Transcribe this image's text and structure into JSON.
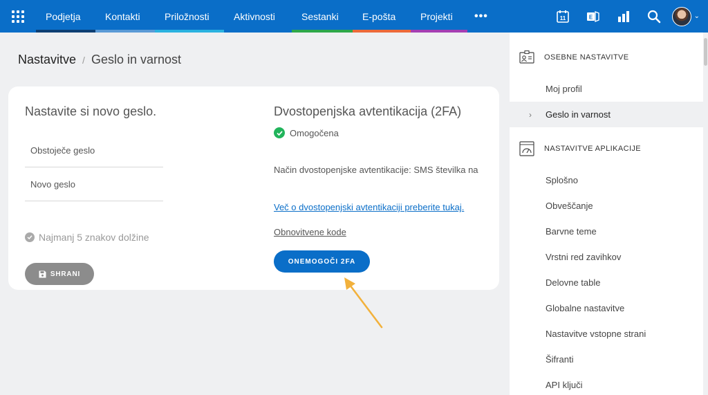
{
  "nav": {
    "tabs": [
      {
        "label": "Podjetja",
        "color": "#0d3f73"
      },
      {
        "label": "Kontakti",
        "color": "#5b9ad6"
      },
      {
        "label": "Priložnosti",
        "color": "#2ab2e0"
      },
      {
        "label": "Aktivnosti",
        "color": "#0a6ec8"
      },
      {
        "label": "Sestanki",
        "color": "#2ea84a"
      },
      {
        "label": "E-pošta",
        "color": "#ec6a3a"
      },
      {
        "label": "Projekti",
        "color": "#a53fb3"
      }
    ],
    "calendar_day": "11",
    "icons": [
      "apps-grid-icon",
      "more-icon",
      "calendar-icon",
      "exchange-icon",
      "reports-icon",
      "search-icon",
      "avatar"
    ]
  },
  "breadcrumb": {
    "root": "Nastavitve",
    "separator": "/",
    "current": "Geslo in varnost"
  },
  "password": {
    "title": "Nastavite si novo geslo.",
    "current_placeholder": "Obstoječe geslo",
    "new_placeholder": "Novo geslo",
    "requirement": "Najmanj 5 znakov dolžine",
    "save_label": "SHRANI"
  },
  "twofa": {
    "title": "Dvostopenjska avtentikacija (2FA)",
    "status": "Omogočena",
    "method": "Način dvostopenjske avtentikacije: SMS številka na",
    "info_link": "Več o dvostopenjski avtentikaciji preberite tukaj.",
    "recovery_link": "Obnovitvene kode",
    "disable_label": "ONEMOGOČI 2FA"
  },
  "sidebar": {
    "personal_header": "OSEBNE NASTAVITVE",
    "personal_items": [
      {
        "label": "Moj profil"
      },
      {
        "label": "Geslo in varnost"
      }
    ],
    "app_header": "NASTAVITVE APLIKACIJE",
    "app_items": [
      {
        "label": "Splošno"
      },
      {
        "label": "Obveščanje"
      },
      {
        "label": "Barvne teme"
      },
      {
        "label": "Vrstni red zavihkov"
      },
      {
        "label": "Delovne table"
      },
      {
        "label": "Globalne nastavitve"
      },
      {
        "label": "Nastavitve vstopne strani"
      },
      {
        "label": "Šifranti"
      },
      {
        "label": "API ključi"
      }
    ]
  },
  "colors": {
    "primary": "#0a6ec8",
    "success": "#21b45b",
    "arrow": "#f2b13c"
  }
}
